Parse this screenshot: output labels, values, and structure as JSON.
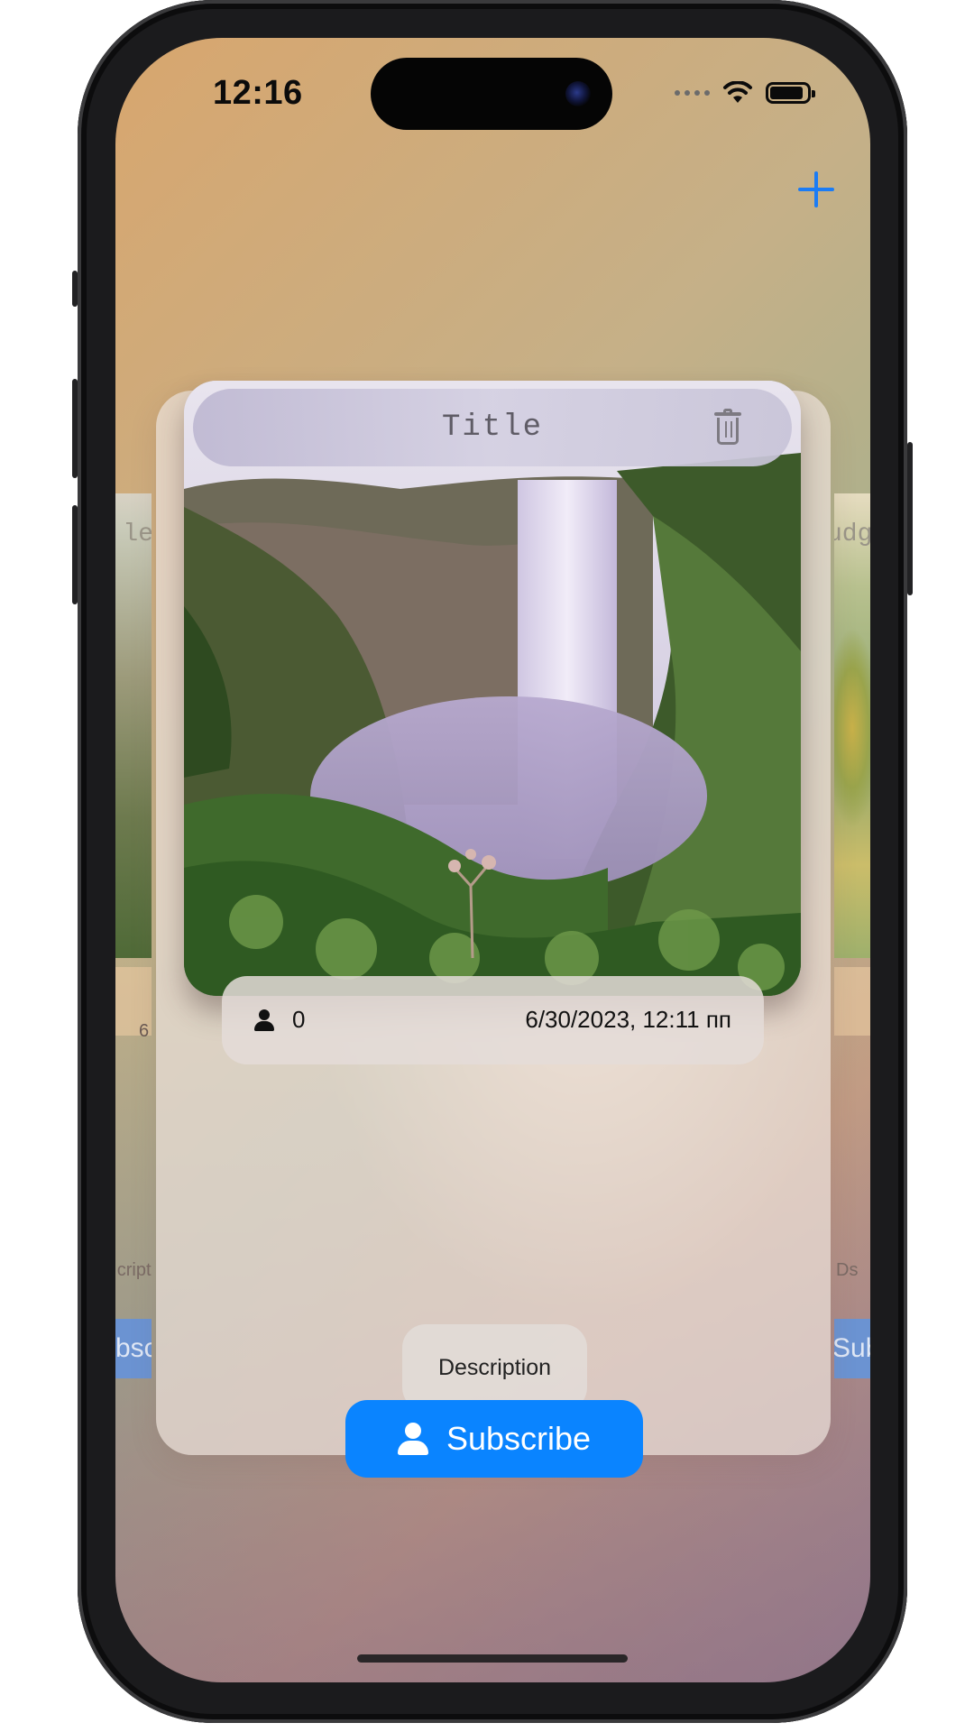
{
  "status_bar": {
    "time": "12:16"
  },
  "toolbar": {
    "add_icon": "plus-icon",
    "accent_color": "#1b7cf5"
  },
  "card": {
    "title": "Title",
    "delete_icon": "trash-icon",
    "subscriber_count": "0",
    "date": "6/30/2023, 12:11 пп",
    "description": "Description",
    "subscribe_label": "Subscribe",
    "subscribe_color": "#0a84ff"
  },
  "side_cards": {
    "left": {
      "title_fragment": "le",
      "count_fragment": "6",
      "description_fragment": "cripti",
      "subscribe_fragment": "bsc"
    },
    "right": {
      "title_fragment": "udg",
      "description_fragment": "Ds",
      "subscribe_fragment": "Subs"
    }
  }
}
